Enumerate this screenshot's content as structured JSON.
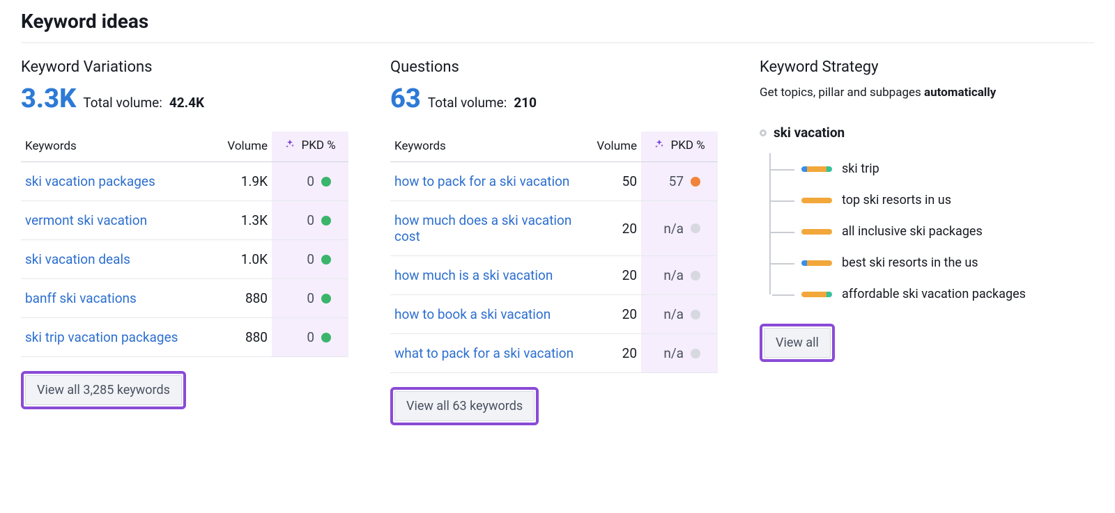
{
  "page": {
    "title": "Keyword ideas"
  },
  "columns": {
    "variations": {
      "title": "Keyword Variations",
      "count": "3.3K",
      "total_volume_label": "Total volume:",
      "total_volume": "42.4K",
      "headers": {
        "keywords": "Keywords",
        "volume": "Volume",
        "pkd": "PKD %"
      },
      "rows": [
        {
          "keyword": "ski vacation packages",
          "volume": "1.9K",
          "pkd": "0",
          "pkd_color": "green"
        },
        {
          "keyword": "vermont ski vacation",
          "volume": "1.3K",
          "pkd": "0",
          "pkd_color": "green"
        },
        {
          "keyword": "ski vacation deals",
          "volume": "1.0K",
          "pkd": "0",
          "pkd_color": "green"
        },
        {
          "keyword": "banff ski vacations",
          "volume": "880",
          "pkd": "0",
          "pkd_color": "green"
        },
        {
          "keyword": "ski trip vacation packages",
          "volume": "880",
          "pkd": "0",
          "pkd_color": "green"
        }
      ],
      "view_all": "View all 3,285 keywords"
    },
    "questions": {
      "title": "Questions",
      "count": "63",
      "total_volume_label": "Total volume:",
      "total_volume": "210",
      "headers": {
        "keywords": "Keywords",
        "volume": "Volume",
        "pkd": "PKD %"
      },
      "rows": [
        {
          "keyword": "how to pack for a ski vacation",
          "volume": "50",
          "pkd": "57",
          "pkd_color": "orange"
        },
        {
          "keyword": "how much does a ski vacation cost",
          "volume": "20",
          "pkd": "n/a",
          "pkd_color": "grey"
        },
        {
          "keyword": "how much is a ski vacation",
          "volume": "20",
          "pkd": "n/a",
          "pkd_color": "grey"
        },
        {
          "keyword": "how to book a ski vacation",
          "volume": "20",
          "pkd": "n/a",
          "pkd_color": "grey"
        },
        {
          "keyword": "what to pack for a ski vacation",
          "volume": "20",
          "pkd": "n/a",
          "pkd_color": "grey"
        }
      ],
      "view_all": "View all 63 keywords"
    },
    "strategy": {
      "title": "Keyword Strategy",
      "subtitle_pre": "Get topics, pillar and subpages ",
      "subtitle_bold": "automatically",
      "root": "ski vacation",
      "items": [
        {
          "label": "ski trip",
          "segments": [
            "blue",
            "orange",
            "teal"
          ]
        },
        {
          "label": "top ski resorts in us",
          "segments": [
            "orange"
          ]
        },
        {
          "label": "all inclusive ski packages",
          "segments": [
            "orange"
          ]
        },
        {
          "label": "best ski resorts in the us",
          "segments": [
            "blue",
            "orange"
          ]
        },
        {
          "label": "affordable ski vacation packages",
          "segments": [
            "orange",
            "teal"
          ]
        }
      ],
      "view_all": "View all"
    }
  }
}
